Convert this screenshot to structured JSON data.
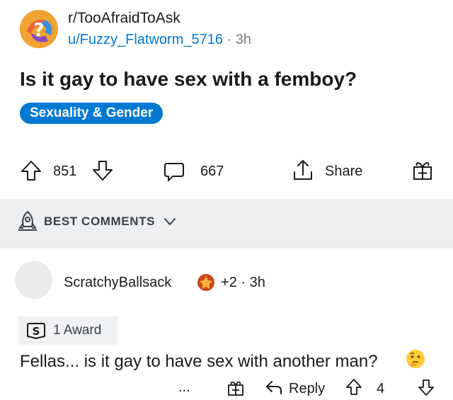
{
  "post": {
    "subreddit": "r/TooAfraidToAsk",
    "author": "u/Fuzzy_Flatworm_5716",
    "separator": "·",
    "age": "3h",
    "title": "Is it gay to have sex with a femboy?",
    "flair": "Sexuality & Gender",
    "flair_color": "#0079d3"
  },
  "actions": {
    "upvotes": "851",
    "comments": "667",
    "share_label": "Share"
  },
  "sort": {
    "label": "BEST COMMENTS"
  },
  "comment": {
    "author": "ScratchyBallsack",
    "karma": "+2",
    "separator": "·",
    "age": "3h",
    "award_text": "1 Award",
    "body": "Fellas... is it gay to have sex with another man?",
    "more_label": "...",
    "reply_label": "Reply",
    "votes": "4"
  },
  "icons": [
    "subreddit-icon",
    "upvote-icon",
    "downvote-icon",
    "comment-icon",
    "share-icon",
    "gift-icon",
    "rocket-icon",
    "chevron-down-icon",
    "award-icon",
    "thinking-face-icon",
    "reply-icon"
  ]
}
